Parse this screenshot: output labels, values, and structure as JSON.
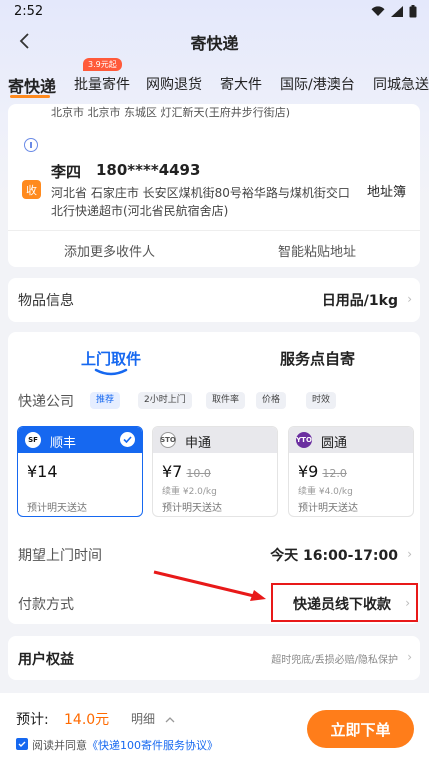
{
  "status_bar": {
    "time": "2:52"
  },
  "header": {
    "title": "寄快递"
  },
  "tabs": [
    {
      "label": "寄快递",
      "active": true
    },
    {
      "label": "批量寄件",
      "badge": "3.9元起"
    },
    {
      "label": "网购退货"
    },
    {
      "label": "寄大件"
    },
    {
      "label": "国际/港澳台"
    },
    {
      "label": "同城急送"
    }
  ],
  "address": {
    "sender_partial": "北京市 北京市 东城区 灯汇新天(王府井步行街店)",
    "receiver_icon_text": "收",
    "receiver_name": "李四",
    "receiver_phone": "180****4493",
    "receiver_address": "河北省 石家庄市 长安区煤机街80号裕华路与煤机街交口北行快递超市(河北省民航宿舍店)",
    "address_book": "地址簿",
    "add_more": "添加更多收件人",
    "smart_paste": "智能粘贴地址"
  },
  "goods": {
    "label": "物品信息",
    "value": "日用品/1kg"
  },
  "mode": {
    "onsite": "上门取件",
    "self_send": "服务点自寄"
  },
  "courier": {
    "label": "快递公司",
    "chips": [
      "推荐",
      "2小时上门",
      "取件率",
      "价格",
      "时效"
    ],
    "options": [
      {
        "name": "顺丰",
        "logo": "SF",
        "price": "¥14",
        "orig": "",
        "extra": "",
        "eta": "预计明天送达",
        "selected": true,
        "logo_color": "#111"
      },
      {
        "name": "申通",
        "logo": "STO",
        "price": "¥7",
        "orig": "10.0",
        "extra": "续重 ¥2.0/kg",
        "eta": "预计明天送达",
        "selected": false,
        "logo_color": "#555"
      },
      {
        "name": "圆通",
        "logo": "YTO",
        "price": "¥9",
        "orig": "12.0",
        "extra": "续重 ¥4.0/kg",
        "eta": "预计明天送达",
        "selected": false,
        "logo_color": "#6b2fa0"
      }
    ]
  },
  "pickup_time": {
    "label": "期望上门时间",
    "value": "今天 16:00-17:00"
  },
  "payment": {
    "label": "付款方式",
    "value": "快递员线下收款"
  },
  "benefits": {
    "label": "用户权益",
    "desc": "超时兜底/丢损必赔/隐私保护"
  },
  "bottom": {
    "estimate_label": "预计:",
    "estimate_value": "14.0元",
    "detail": "明细",
    "order_button": "立即下单",
    "agree_prefix": "阅读并同意",
    "agree_link": "《快递100寄件服务协议》"
  },
  "colors": {
    "brand_blue": "#1668f0",
    "accent_orange": "#ff7d1a",
    "highlight_red": "#e81919"
  }
}
